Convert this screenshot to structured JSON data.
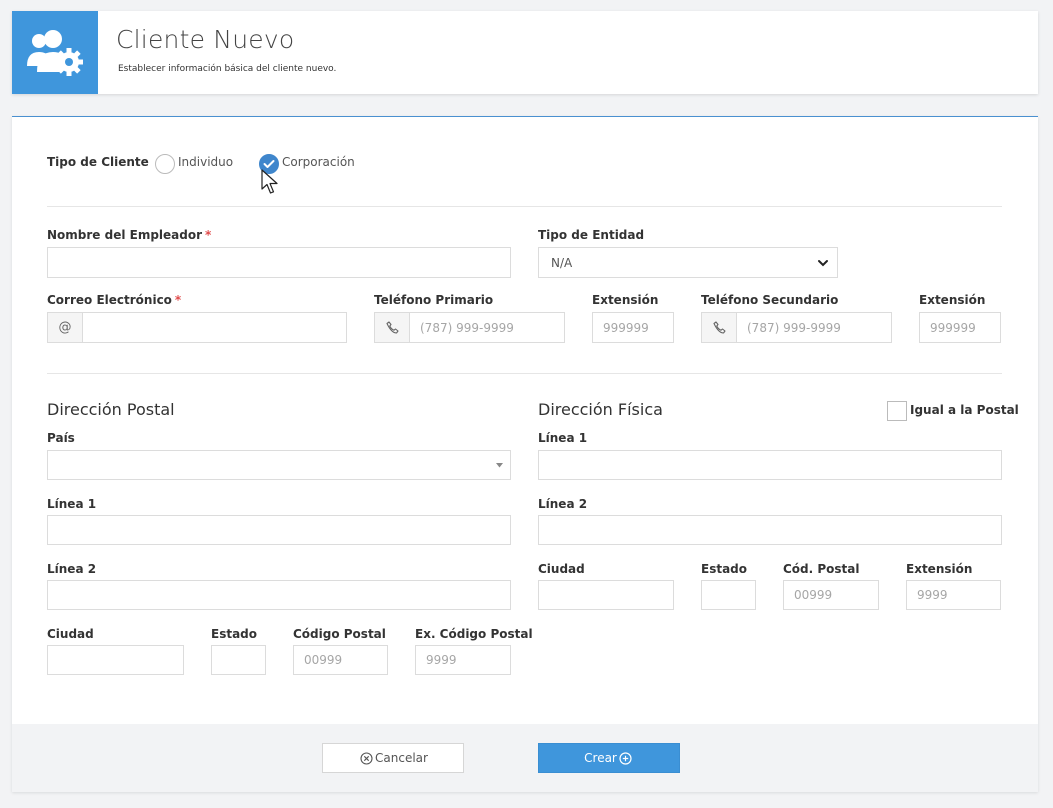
{
  "header": {
    "title": "Cliente Nuevo",
    "subtitle": "Establecer información básica del cliente nuevo."
  },
  "client_type": {
    "label": "Tipo de Cliente",
    "options": [
      {
        "label": "Individuo",
        "checked": false
      },
      {
        "label": "Corporación",
        "checked": true
      }
    ]
  },
  "employer": {
    "label": "Nombre del Empleador",
    "required_mark": "*",
    "value": ""
  },
  "entity_type": {
    "label": "Tipo de Entidad",
    "selected": "N/A"
  },
  "email": {
    "label": "Correo Electrónico",
    "required_mark": "*",
    "addon": "@",
    "value": ""
  },
  "primary_phone": {
    "label": "Teléfono Primario",
    "placeholder": "(787) 999-9999",
    "ext_label": "Extensión",
    "ext_placeholder": "999999"
  },
  "secondary_phone": {
    "label": "Teléfono Secundario",
    "placeholder": "(787) 999-9999",
    "ext_label": "Extensión",
    "ext_placeholder": "999999"
  },
  "postal_address": {
    "title": "Dirección Postal",
    "country_label": "País",
    "country_value": "",
    "line1_label": "Línea 1",
    "line2_label": "Línea 2",
    "city_label": "Ciudad",
    "state_label": "Estado",
    "zip_label": "Código Postal",
    "zip_placeholder": "00999",
    "zip_ext_label": "Ex. Código Postal",
    "zip_ext_placeholder": "9999"
  },
  "physical_address": {
    "title": "Dirección Física",
    "same_as_postal_label": "Igual a la Postal",
    "same_as_postal_checked": false,
    "line1_label": "Línea 1",
    "line2_label": "Línea 2",
    "city_label": "Ciudad",
    "state_label": "Estado",
    "zip_label": "Cód. Postal",
    "zip_placeholder": "00999",
    "zip_ext_label": "Extensión",
    "zip_ext_placeholder": "9999"
  },
  "actions": {
    "cancel_label": "Cancelar",
    "create_label": "Crear"
  },
  "colors": {
    "accent": "#3f96dc",
    "required": "#e04b4b",
    "radio_checked": "#3f86cc"
  },
  "icons": [
    "users-gear-icon",
    "check-icon",
    "phone-icon",
    "at-icon",
    "chevron-down-icon",
    "caret-down-icon",
    "close-circle-icon",
    "plus-circle-icon",
    "mouse-cursor-icon"
  ]
}
